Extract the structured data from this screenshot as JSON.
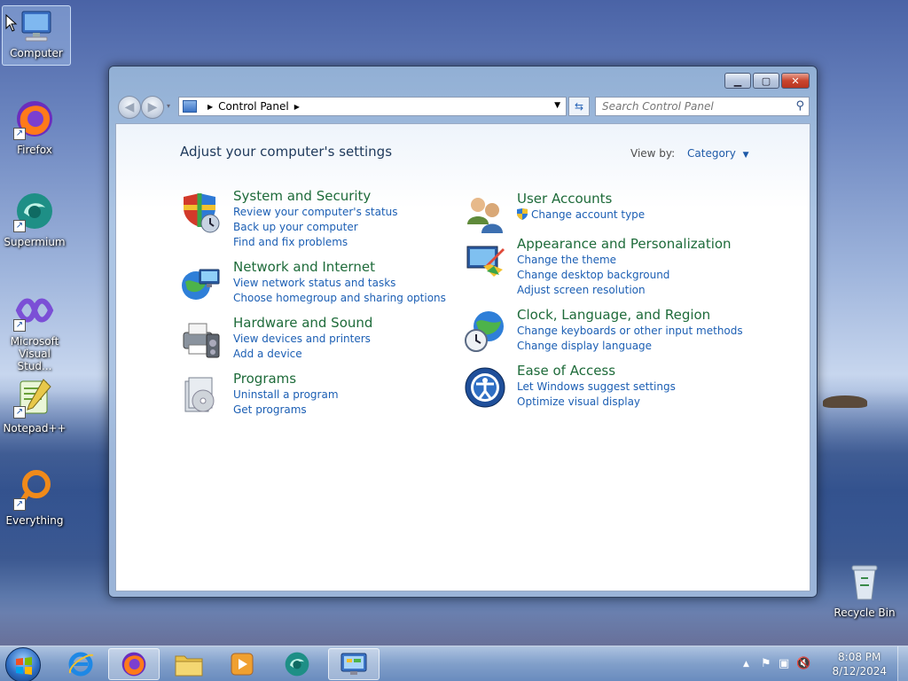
{
  "desktop": {
    "icons": [
      {
        "label": "Computer"
      },
      {
        "label": "Firefox"
      },
      {
        "label": "Supermium"
      },
      {
        "label": "Microsoft Visual Stud..."
      },
      {
        "label": "Notepad++"
      },
      {
        "label": "Everything"
      },
      {
        "label": "Recycle Bin"
      }
    ]
  },
  "window": {
    "breadcrumb": "Control Panel",
    "search_placeholder": "Search Control Panel",
    "heading": "Adjust your computer's settings",
    "view_by_label": "View by:",
    "view_by_value": "Category",
    "categories": [
      {
        "title": "System and Security",
        "icon": "shield-icon",
        "links": [
          "Review your computer's status",
          "Back up your computer",
          "Find and fix problems"
        ]
      },
      {
        "title": "Network and Internet",
        "icon": "network-icon",
        "links": [
          "View network status and tasks",
          "Choose homegroup and sharing options"
        ]
      },
      {
        "title": "Hardware and Sound",
        "icon": "printer-icon",
        "links": [
          "View devices and printers",
          "Add a device"
        ]
      },
      {
        "title": "Programs",
        "icon": "programs-icon",
        "links": [
          "Uninstall a program",
          "Get programs"
        ]
      },
      {
        "title": "User Accounts",
        "icon": "users-icon",
        "links": [
          "Change account type"
        ]
      },
      {
        "title": "Appearance and Personalization",
        "icon": "appearance-icon",
        "links": [
          "Change the theme",
          "Change desktop background",
          "Adjust screen resolution"
        ]
      },
      {
        "title": "Clock, Language, and Region",
        "icon": "globe-clock-icon",
        "links": [
          "Change keyboards or other input methods",
          "Change display language"
        ]
      },
      {
        "title": "Ease of Access",
        "icon": "ease-of-access-icon",
        "links": [
          "Let Windows suggest settings",
          "Optimize visual display"
        ]
      }
    ]
  },
  "taskbar": {
    "time": "8:08 PM",
    "date": "8/12/2024",
    "pinned": [
      "internet-explorer-icon",
      "firefox-icon",
      "explorer-icon",
      "media-player-icon",
      "supermium-icon",
      "control-panel-icon"
    ]
  },
  "colors": {
    "category_title": "#1e6b3a",
    "link": "#1c5fb4",
    "heading": "#1e395b"
  }
}
